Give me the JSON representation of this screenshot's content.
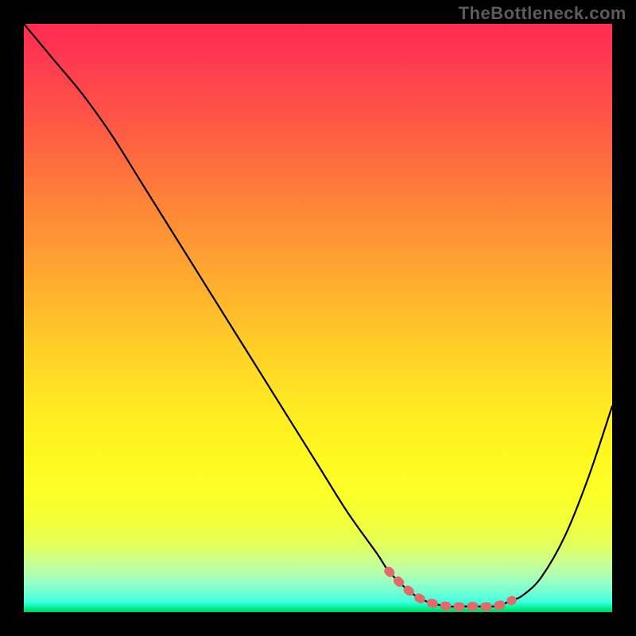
{
  "watermark": "TheBottleneck.com",
  "chart_data": {
    "type": "line",
    "title": "",
    "xlabel": "",
    "ylabel": "",
    "xlim": [
      0,
      100
    ],
    "ylim": [
      0,
      100
    ],
    "x": [
      0,
      5,
      10,
      15,
      20,
      25,
      30,
      35,
      40,
      45,
      50,
      55,
      60,
      62,
      65,
      68,
      72,
      76,
      80,
      83,
      85,
      88,
      92,
      96,
      100
    ],
    "y": [
      100,
      94,
      88,
      81,
      73,
      65,
      57,
      49,
      41,
      33,
      25,
      17,
      10,
      7,
      4,
      2,
      1,
      1,
      1,
      2,
      3,
      6,
      13,
      23,
      35
    ],
    "highlight_range_x": [
      62,
      83
    ],
    "colors": {
      "top": "#ff2b52",
      "mid": "#ffe722",
      "bottom": "#00d15e",
      "curve": "#000000",
      "highlight": "#e26a6a"
    }
  }
}
